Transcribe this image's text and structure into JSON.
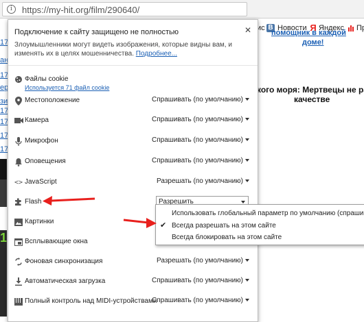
{
  "browser": {
    "url": "https://my-hit.org/film/290640/",
    "bookmarks": [
      {
        "icon": "vk-icon",
        "label": "Новости"
      },
      {
        "icon": "yandex-icon",
        "label": "Яндекс"
      },
      {
        "icon": "bookmark-icon",
        "label": "Пр"
      }
    ],
    "partial_bookmark": "ис"
  },
  "background_page": {
    "left_numbers": [
      "17",
      "17",
      "17",
      "17",
      "17",
      "17"
    ],
    "left_partial": [
      "ан",
      "ер",
      "зи"
    ],
    "green_char": "1",
    "heading_line1": "кого моря: Мертвецы не расс",
    "heading_line2": "качестве",
    "top_link": "помощник в каждой",
    "top_link2": "доме!"
  },
  "site_info": {
    "title": "Подключение к сайту защищено не полностью",
    "description": "Злоумышленники могут видеть изображения, которые видны вам, и изменять их в целях мошенничества.",
    "more_link": "Подробнее...",
    "cookies": {
      "label": "Файлы cookie",
      "sub": "Используется 71 файл cookie"
    },
    "permissions": [
      {
        "name": "location",
        "icon": "location-pin-icon",
        "label": "Местоположение",
        "value": "Спрашивать (по умолчанию)"
      },
      {
        "name": "camera",
        "icon": "camera-icon",
        "label": "Камера",
        "value": "Спрашивать (по умолчанию)"
      },
      {
        "name": "microphone",
        "icon": "microphone-icon",
        "label": "Микрофон",
        "value": "Спрашивать (по умолчанию)"
      },
      {
        "name": "notifications",
        "icon": "bell-icon",
        "label": "Оповещения",
        "value": "Спрашивать (по умолчанию)"
      },
      {
        "name": "javascript",
        "icon": "code-brackets-icon",
        "label": "JavaScript",
        "value": "Разрешать (по умолчанию)"
      },
      {
        "name": "flash",
        "icon": "puzzle-icon",
        "label": "Flash",
        "value": "Разрешить"
      },
      {
        "name": "images",
        "icon": "image-icon",
        "label": "Картинки",
        "value": ""
      },
      {
        "name": "popups",
        "icon": "popup-window-icon",
        "label": "Всплывающие окна",
        "value": ""
      },
      {
        "name": "background_sync",
        "icon": "sync-icon",
        "label": "Фоновая синхронизация",
        "value": "Разрешать (по умолчанию)"
      },
      {
        "name": "auto_download",
        "icon": "download-icon",
        "label": "Автоматическая загрузка",
        "value": "Спрашивать (по умолчанию)"
      },
      {
        "name": "midi",
        "icon": "midi-keyboard-icon",
        "label": "Полный контроль над MIDI-устройствами",
        "value": "Спрашивать (по умолчанию)"
      }
    ],
    "flash_dropdown": {
      "options": [
        "Использовать глобальный параметр по умолчанию (спрашивать)",
        "Всегда разрешать на этом сайте",
        "Всегда блокировать на этом сайте"
      ],
      "checked_index": 1
    },
    "close_icon": "close-icon"
  },
  "colors": {
    "accent_link": "#1a5fb4",
    "arrow_red": "#e8201d"
  }
}
